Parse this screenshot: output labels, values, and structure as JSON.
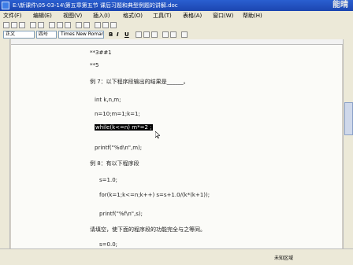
{
  "window": {
    "title": "E:\\新课件\\05-03-14\\第五章第五节 课后习题和典型例题的讲解.doc",
    "watermark": "能晴"
  },
  "menu": [
    "文件(F)",
    "编辑(E)",
    "视图(V)",
    "插入(I)",
    "格式(O)",
    "工具(T)",
    "表格(A)",
    "窗口(W)",
    "帮助(H)"
  ],
  "format": {
    "style": "正文",
    "size": "四号",
    "font": "Times New Roman",
    "bold": "B",
    "italic": "I",
    "underline": "U"
  },
  "doc": {
    "lines": [
      "**3##1",
      "**5",
      "例 7：以下程序段输出的结果是______。",
      "int k,n,m;",
      "n=10;m=1;k=1;",
      "while(k<=n) m*=2 ;",
      "printf(\"%d\\n\",m);",
      "例 8：有以下程序段",
      "s=1.0;",
      "for(k=1;k<=n;k++)    s=s+1.0/(k*(k+1));",
      "printf(\"%f\\n\",s);",
      "请填空，使下面的程序段的功能完全与之等同。",
      "s=0.0;"
    ]
  },
  "status": {
    "text": "未知区域"
  }
}
